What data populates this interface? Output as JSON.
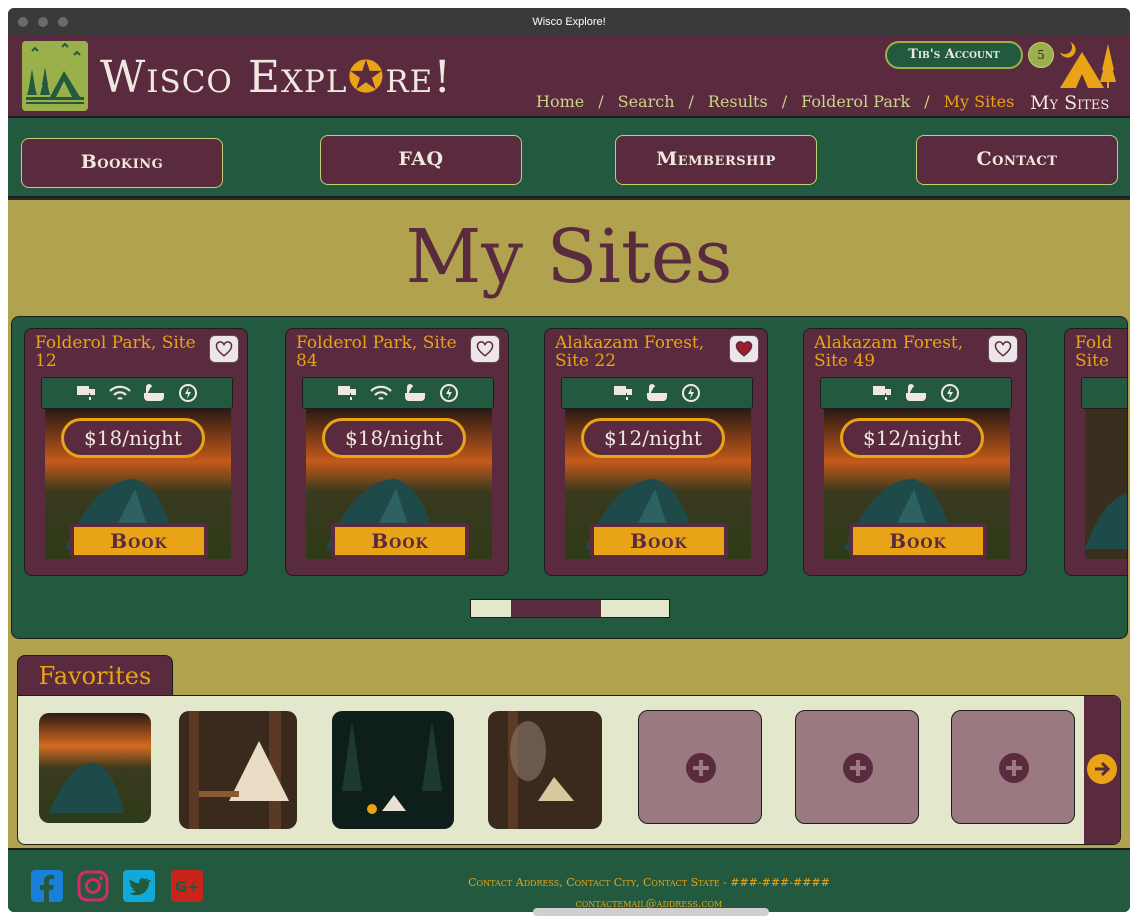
{
  "window": {
    "title": "Wisco Explore!"
  },
  "header": {
    "brand_left": "Wisco Expl",
    "brand_right": "re!",
    "account_label": "Tib's Account",
    "badge_count": "5",
    "mysites_label": "My Sites",
    "breadcrumb": [
      "Home",
      "Search",
      "Results",
      "Folderol Park",
      "My Sites"
    ],
    "breadcrumb_sep": "/"
  },
  "nav": {
    "booking": "Booking",
    "faq": "FAQ",
    "membership": "Membership",
    "contact": "Contact"
  },
  "main": {
    "title": "My Sites"
  },
  "cards": [
    {
      "title": "Folderol Park, Site 12",
      "price": "$18/night",
      "book": "Book",
      "favorited": false,
      "amenities": [
        "faucet-icon",
        "wifi-icon",
        "bathtub-icon",
        "electric-icon"
      ]
    },
    {
      "title": "Folderol Park, Site 84",
      "price": "$18/night",
      "book": "Book",
      "favorited": false,
      "amenities": [
        "faucet-icon",
        "wifi-icon",
        "bathtub-icon",
        "electric-icon"
      ]
    },
    {
      "title": "Alakazam Forest, Site 22",
      "price": "$12/night",
      "book": "Book",
      "favorited": true,
      "amenities": [
        "faucet-icon",
        "bathtub-icon",
        "electric-icon"
      ]
    },
    {
      "title": "Alakazam Forest, Site 49",
      "price": "$12/night",
      "book": "Book",
      "favorited": false,
      "amenities": [
        "faucet-icon",
        "bathtub-icon",
        "electric-icon"
      ]
    },
    {
      "title": "Fold Site",
      "price": "",
      "book": "",
      "favorited": false,
      "amenities": []
    }
  ],
  "favorites": {
    "title": "Favorites",
    "photo_count": 4,
    "empty_slots": 3
  },
  "footer": {
    "address": "Contact Address, Contact City, Contact State - ###-###-####",
    "email": "contactemail@address.com",
    "social": [
      "facebook-icon",
      "instagram-icon",
      "twitter-icon",
      "google-plus-icon"
    ]
  },
  "colors": {
    "maroon": "#5a2a3e",
    "forest": "#235a3f",
    "mustard": "#b0a24e",
    "gold": "#e8a416",
    "cream": "#e3e7cc"
  }
}
